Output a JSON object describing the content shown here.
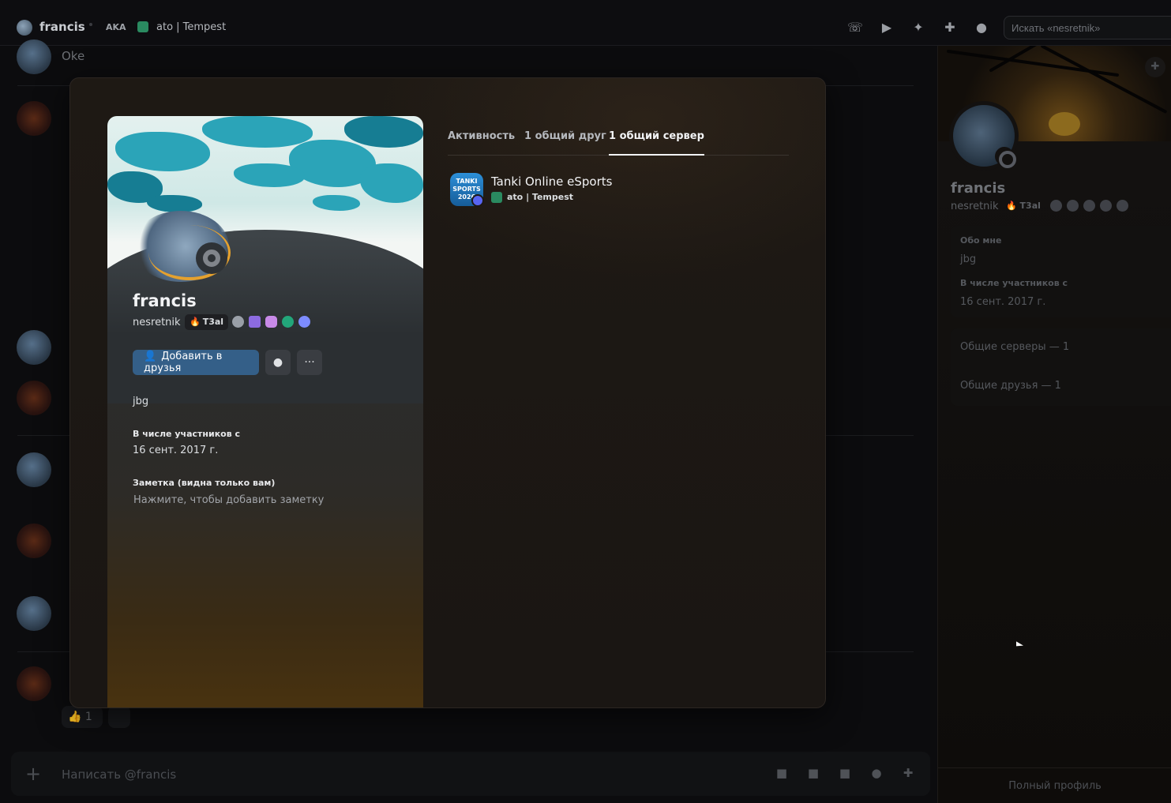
{
  "header": {
    "dm_name": "francis",
    "aka_label": "AKA",
    "aka_name": "ato | Tempest",
    "search_placeholder": "Искать «nesretnik»",
    "icons": [
      "phone-icon",
      "video-icon",
      "pin-icon",
      "add-friend-icon",
      "profile-icon"
    ]
  },
  "chat": {
    "message_ok": "Oke",
    "reaction_count": "1",
    "composer_placeholder": "Написать @francis",
    "composer_icons": [
      "gift-icon",
      "gif-icon",
      "sticker-icon",
      "emoji-icon",
      "apps-icon"
    ]
  },
  "side_panel": {
    "display_name": "francis",
    "username": "nesretnik",
    "tag": "T3al",
    "about_label": "Обо мне",
    "about_text": "jbg",
    "member_since_label": "В числе участников с",
    "member_since": "16 сент. 2017 г.",
    "mutual_servers": "Общие серверы — 1",
    "mutual_friends": "Общие друзья — 1",
    "full_profile": "Полный профиль"
  },
  "modal": {
    "display_name": "francis",
    "username": "nesretnik",
    "tag": "T3al",
    "add_friend_label": "Добавить в друзья",
    "bio": "jbg",
    "member_since_label": "В числе участников с",
    "member_since": "16 сент. 2017 г.",
    "note_label": "Заметка (видна только вам)",
    "note_placeholder": "Нажмите, чтобы добавить заметку",
    "tabs": [
      "Активность",
      "1 общий друг",
      "1 общий сервер"
    ],
    "active_tab": "1 общий сервер",
    "server": {
      "icon_text": "TANKI SPORTS 2026",
      "name": "Tanki Online eSports",
      "nickname": "ato | Tempest"
    }
  },
  "colors": {
    "accent_button": "#345f88",
    "background": "#0b0b0d",
    "modal_bg": "#1e1914"
  }
}
